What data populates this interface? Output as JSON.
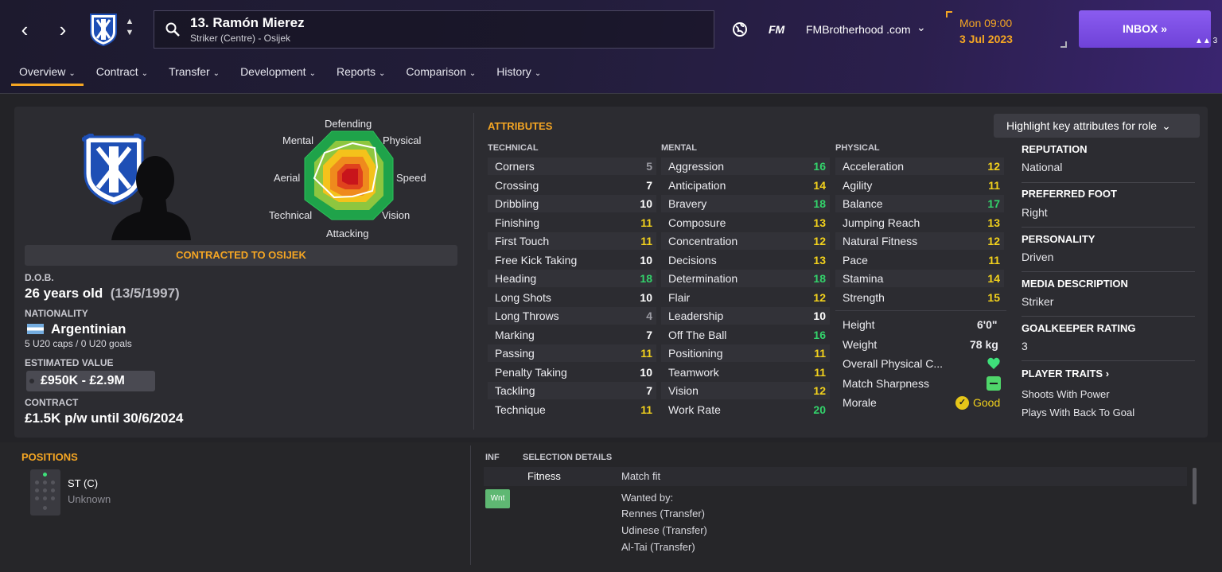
{
  "header": {
    "player_title": "13. Ramón Mierez",
    "player_subtitle": "Striker (Centre) - Osijek",
    "fm_logo": "FM",
    "site": "FMBrotherhood .com",
    "date_day": "Mon 09:00",
    "date_date": "3 Jul 2023",
    "inbox_label": "INBOX",
    "inbox_count": "3",
    "icons": [
      "back-arrow-icon",
      "forward-arrow-icon",
      "club-crest-icon",
      "search-icon",
      "globe-icon",
      "chevron-down-icon",
      "inbox-arrow-icon"
    ]
  },
  "tabs": [
    {
      "label": "Overview",
      "active": true
    },
    {
      "label": "Contract"
    },
    {
      "label": "Transfer"
    },
    {
      "label": "Development"
    },
    {
      "label": "Reports"
    },
    {
      "label": "Comparison"
    },
    {
      "label": "History"
    }
  ],
  "radar": {
    "labels": [
      "Defending",
      "Physical",
      "Speed",
      "Vision",
      "Attacking",
      "Technical",
      "Aerial",
      "Mental"
    ]
  },
  "profile": {
    "contracted": "CONTRACTED TO OSIJEK",
    "dob_label": "D.O.B.",
    "age": "26 years old",
    "dob": "(13/5/1997)",
    "nationality_label": "NATIONALITY",
    "nationality": "Argentinian",
    "caps": "5 U20 caps / 0 U20 goals",
    "value_label": "ESTIMATED VALUE",
    "value": "£950K - £2.9M",
    "contract_label": "CONTRACT",
    "contract": "£1.5K p/w until 30/6/2024"
  },
  "attributes": {
    "title": "ATTRIBUTES",
    "highlight_button": "Highlight key attributes for role",
    "technical_label": "TECHNICAL",
    "mental_label": "MENTAL",
    "physical_label": "PHYSICAL",
    "technical": [
      {
        "name": "Corners",
        "value": "5"
      },
      {
        "name": "Crossing",
        "value": "7"
      },
      {
        "name": "Dribbling",
        "value": "10"
      },
      {
        "name": "Finishing",
        "value": "11"
      },
      {
        "name": "First Touch",
        "value": "11"
      },
      {
        "name": "Free Kick Taking",
        "value": "10"
      },
      {
        "name": "Heading",
        "value": "18"
      },
      {
        "name": "Long Shots",
        "value": "10"
      },
      {
        "name": "Long Throws",
        "value": "4"
      },
      {
        "name": "Marking",
        "value": "7"
      },
      {
        "name": "Passing",
        "value": "11"
      },
      {
        "name": "Penalty Taking",
        "value": "10"
      },
      {
        "name": "Tackling",
        "value": "7"
      },
      {
        "name": "Technique",
        "value": "11"
      }
    ],
    "mental": [
      {
        "name": "Aggression",
        "value": "16"
      },
      {
        "name": "Anticipation",
        "value": "14"
      },
      {
        "name": "Bravery",
        "value": "18"
      },
      {
        "name": "Composure",
        "value": "13"
      },
      {
        "name": "Concentration",
        "value": "12"
      },
      {
        "name": "Decisions",
        "value": "13"
      },
      {
        "name": "Determination",
        "value": "18"
      },
      {
        "name": "Flair",
        "value": "12"
      },
      {
        "name": "Leadership",
        "value": "10"
      },
      {
        "name": "Off The Ball",
        "value": "16"
      },
      {
        "name": "Positioning",
        "value": "11"
      },
      {
        "name": "Teamwork",
        "value": "11"
      },
      {
        "name": "Vision",
        "value": "12"
      },
      {
        "name": "Work Rate",
        "value": "20"
      }
    ],
    "physical": [
      {
        "name": "Acceleration",
        "value": "12"
      },
      {
        "name": "Agility",
        "value": "11"
      },
      {
        "name": "Balance",
        "value": "17"
      },
      {
        "name": "Jumping Reach",
        "value": "13"
      },
      {
        "name": "Natural Fitness",
        "value": "12"
      },
      {
        "name": "Pace",
        "value": "11"
      },
      {
        "name": "Stamina",
        "value": "14"
      },
      {
        "name": "Strength",
        "value": "15"
      }
    ],
    "height_label": "Height",
    "height": "6'0\"",
    "weight_label": "Weight",
    "weight": "78 kg",
    "overall_condition_label": "Overall Physical C...",
    "match_sharpness_label": "Match Sharpness",
    "morale_label": "Morale",
    "morale": "Good",
    "colors": {
      "low": "#9b9ba3",
      "mid": "#ffffff",
      "good": "#f2d11c",
      "great": "#33d36b"
    }
  },
  "side_info": {
    "reputation_label": "REPUTATION",
    "reputation": "National",
    "foot_label": "PREFERRED FOOT",
    "foot": "Right",
    "personality_label": "PERSONALITY",
    "personality": "Driven",
    "media_label": "MEDIA DESCRIPTION",
    "media": "Striker",
    "gk_label": "GOALKEEPER RATING",
    "gk": "3",
    "traits_label": "PLAYER TRAITS",
    "traits": [
      "Shoots With Power",
      "Plays With Back To Goal"
    ]
  },
  "positions": {
    "title": "POSITIONS",
    "position": "ST (C)",
    "familiarity": "Unknown"
  },
  "selection": {
    "inf_label": "INF",
    "title": "SELECTION DETAILS",
    "fitness_label": "Fitness",
    "fitness": "Match fit",
    "wnt_badge": "Wnt",
    "wanted_label": "Wanted by:",
    "wanted": [
      "Rennes (Transfer)",
      "Udinese (Transfer)",
      "Al-Tai (Transfer)"
    ]
  },
  "accent_color": "#f5a623",
  "inbox_color": "#7c4ee4"
}
